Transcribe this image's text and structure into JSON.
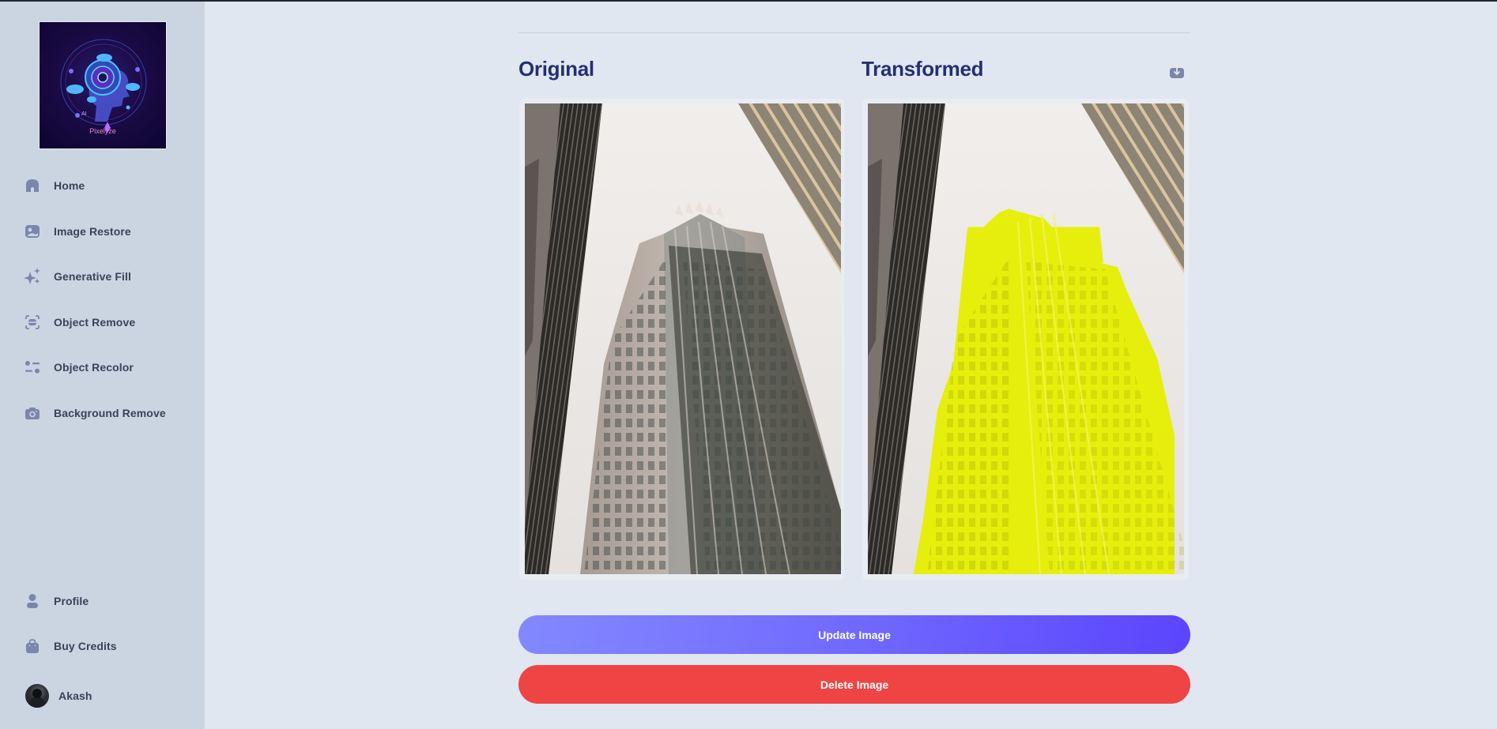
{
  "app": {
    "name": "Pixelyze",
    "logo_caption": "Pixelyze"
  },
  "sidebar": {
    "items": [
      {
        "label": "Home",
        "icon": "home-icon"
      },
      {
        "label": "Image Restore",
        "icon": "image-icon"
      },
      {
        "label": "Generative Fill",
        "icon": "sparkles-icon"
      },
      {
        "label": "Object Remove",
        "icon": "scan-icon"
      },
      {
        "label": "Object Recolor",
        "icon": "filter-icon"
      },
      {
        "label": "Background Remove",
        "icon": "camera-icon"
      }
    ],
    "bottom_items": [
      {
        "label": "Profile",
        "icon": "user-icon"
      },
      {
        "label": "Buy Credits",
        "icon": "bag-icon"
      }
    ],
    "user": {
      "name": "Akash",
      "icon": "avatar"
    }
  },
  "main": {
    "original": {
      "title": "Original",
      "image_alt": "Low-angle photo of a tall skyscraper between two buildings"
    },
    "transformed": {
      "title": "Transformed",
      "image_alt": "Same skyscraper recolored bright yellow",
      "recolor_color": "#e6ef00",
      "download_icon": "download-icon"
    },
    "buttons": {
      "update": "Update Image",
      "delete": "Delete Image"
    }
  },
  "colors": {
    "sidebar_bg": "#cbd5e1",
    "page_bg": "#e1e7f0",
    "title_color": "#243070",
    "icon_color": "#7b86ad",
    "update_gradient_start": "#8289ff",
    "update_gradient_end": "#5a45fd",
    "delete_color": "#ef4444"
  }
}
